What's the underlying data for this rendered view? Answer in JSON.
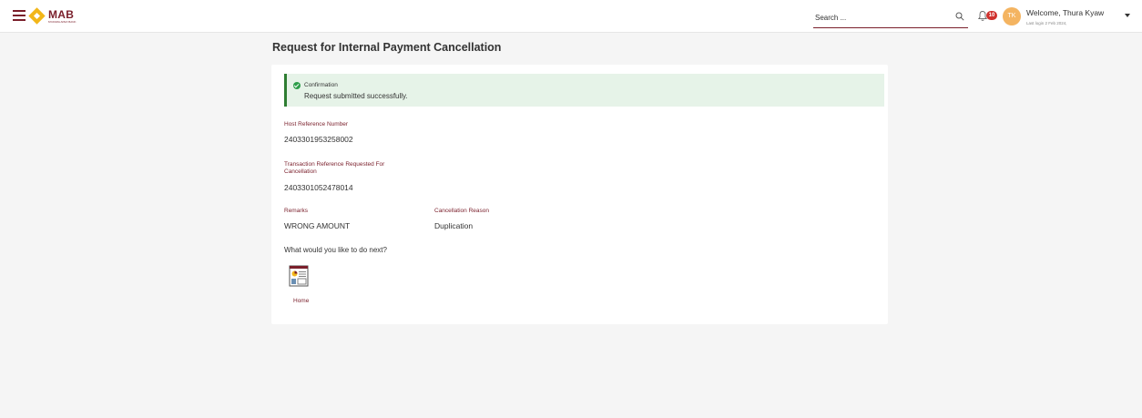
{
  "header": {
    "logo_text": "MAB",
    "logo_tagline": "MYANMA APEX BANK",
    "search_placeholder": "Search ...",
    "notification_count": "10",
    "avatar_initials": "TK",
    "welcome_text": "Welcome, Thura Kyaw",
    "last_login": "Last login 2 Feb 2024,"
  },
  "page": {
    "title": "Request for Internal Payment Cancellation"
  },
  "confirmation": {
    "title": "Confirmation",
    "message": "Request submitted successfully."
  },
  "fields": {
    "host_ref_label": "Host Reference Number",
    "host_ref_value": "2403301953258002",
    "txn_ref_label": "Transaction Reference Requested For Cancellation",
    "txn_ref_value": "2403301052478014",
    "remarks_label": "Remarks",
    "remarks_value": "WRONG AMOUNT",
    "reason_label": "Cancellation Reason",
    "reason_value": "Duplication"
  },
  "next": {
    "question": "What would you like to do next?",
    "home_label": "Home"
  },
  "colors": {
    "brand": "#7a1f2b",
    "logo_gold": "#f2b619",
    "success_bg": "#e6f3e8",
    "success_border": "#2e7d32",
    "badge": "#d0312d",
    "avatar": "#f4b461"
  }
}
